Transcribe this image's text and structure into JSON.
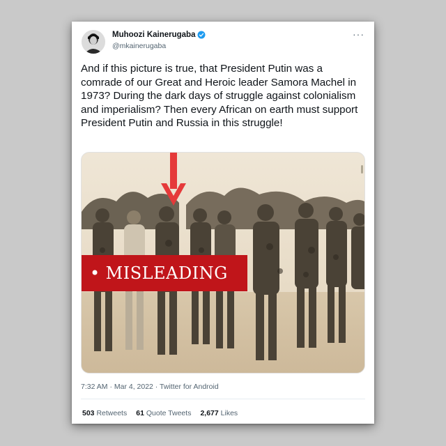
{
  "tweet": {
    "display_name": "Muhoozi Kainerugaba",
    "handle": "@mkainerugaba",
    "verified": true,
    "more_icon": "more-horizontal-icon",
    "more_glyph": "···",
    "text": "And if this picture is true, that President Putin was a comrade of our Great and Heroic leader Samora Machel in 1973? During the dark days of struggle against colonialism and imperialism? Then every African on earth must support President Putin and Russia in this struggle!",
    "timestamp": "7:32 AM · Mar 4, 2022",
    "separator": " · ",
    "source": "Twitter for Android",
    "retweets_count": "503",
    "retweets_label": "Retweets",
    "quote_tweets_count": "61",
    "quote_tweets_label": "Quote Tweets",
    "likes_count": "2,677",
    "likes_label": "Likes"
  },
  "media": {
    "label_bullet": "•",
    "label_text": "MISLEADING",
    "label_color": "#c0151a",
    "arrow_color": "#e53a3a",
    "arrow_icon": "down-arrow-icon"
  },
  "colors": {
    "background": "#c9c9c9",
    "card": "#ffffff",
    "verified": "#1d9bf0",
    "text": "#0f1419",
    "secondary_text": "#536471"
  }
}
